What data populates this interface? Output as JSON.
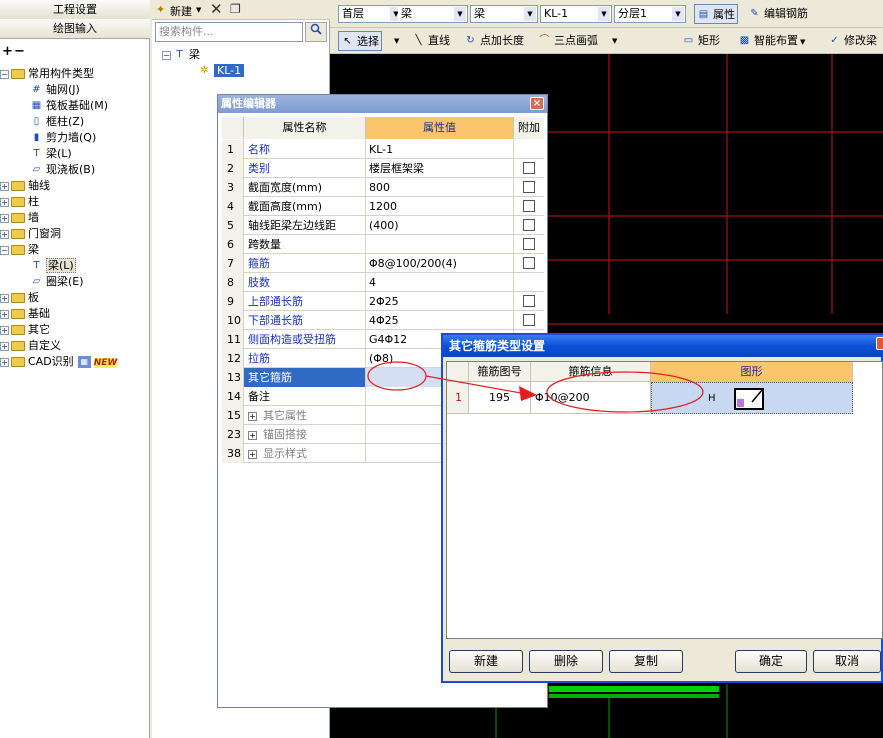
{
  "left_pane": {
    "buttons": [
      "工程设置",
      "绘图输入"
    ],
    "root_label": "常用构件类型",
    "common_items": [
      "轴网(J)",
      "筏板基础(M)",
      "框柱(Z)",
      "剪力墙(Q)",
      "梁(L)",
      "现浇板(B)"
    ],
    "folders_a": [
      "轴线",
      "柱",
      "墙",
      "门窗洞"
    ],
    "beam_folder": "梁",
    "beam_items": [
      "梁(L)",
      "圈梁(E)"
    ],
    "folders_b": [
      "板",
      "基础",
      "其它",
      "自定义"
    ],
    "cad_label": "CAD识别",
    "new_badge": "NEW"
  },
  "mid_pane": {
    "new_label": "新建",
    "search_placeholder": "搜索构件...",
    "tree_root": "梁",
    "tree_child": "KL-1"
  },
  "toolbar1": {
    "floor": "首层",
    "cat1": "梁",
    "cat2": "梁",
    "member": "KL-1",
    "sublayer": "分层1",
    "property": "属性",
    "edit_rebar": "编辑钢筋"
  },
  "toolbar2": {
    "select": "选择",
    "line": "直线",
    "point_length": "点加长度",
    "arc": "三点画弧",
    "rect": "矩形",
    "smart": "智能布置",
    "modify": "修改梁"
  },
  "prop_editor": {
    "title": "属性编辑器",
    "headers": {
      "name": "属性名称",
      "value": "属性值",
      "extra": "附加"
    },
    "rows": [
      {
        "num": "1",
        "name": "名称",
        "value": "KL-1",
        "blue": true,
        "check": false
      },
      {
        "num": "2",
        "name": "类别",
        "value": "楼层框架梁",
        "blue": true,
        "check": true
      },
      {
        "num": "3",
        "name": "截面宽度(mm)",
        "value": "800",
        "blue": false,
        "check": true
      },
      {
        "num": "4",
        "name": "截面高度(mm)",
        "value": "1200",
        "blue": false,
        "check": true
      },
      {
        "num": "5",
        "name": "轴线距梁左边线距",
        "value": "(400)",
        "blue": false,
        "check": true
      },
      {
        "num": "6",
        "name": "跨数量",
        "value": "",
        "blue": false,
        "check": true
      },
      {
        "num": "7",
        "name": "箍筋",
        "value": "Φ8@100/200(4)",
        "blue": true,
        "check": true
      },
      {
        "num": "8",
        "name": "肢数",
        "value": "4",
        "blue": true,
        "check": false
      },
      {
        "num": "9",
        "name": "上部通长筋",
        "value": "2Φ25",
        "blue": true,
        "check": true
      },
      {
        "num": "10",
        "name": "下部通长筋",
        "value": "4Φ25",
        "blue": true,
        "check": true
      },
      {
        "num": "11",
        "name": "侧面构造或受扭筋",
        "value": "G4Φ12",
        "blue": true,
        "check": false
      },
      {
        "num": "12",
        "name": "拉筋",
        "value": "(Φ8)",
        "blue": true,
        "check": false
      },
      {
        "num": "13",
        "name": "其它箍筋",
        "value": "",
        "blue": false,
        "check": false
      },
      {
        "num": "14",
        "name": "备注",
        "value": "",
        "blue": false,
        "check": false
      },
      {
        "num": "15",
        "name": "其它属性",
        "value": "",
        "blue": false,
        "check": false
      },
      {
        "num": "23",
        "name": "锚固搭接",
        "value": "",
        "blue": false,
        "check": false
      },
      {
        "num": "38",
        "name": "显示样式",
        "value": "",
        "blue": false,
        "check": false
      }
    ]
  },
  "stirrup_dialog": {
    "title": "其它箍筋类型设置",
    "headers": [
      "箍筋图号",
      "箍筋信息",
      "图形"
    ],
    "row": {
      "index": "1",
      "code": "195",
      "info": "Φ10@200",
      "shape_label": "H"
    },
    "buttons": {
      "new": "新建",
      "delete": "删除",
      "copy": "复制",
      "ok": "确定",
      "cancel": "取消"
    }
  },
  "colors": {
    "red_grid": "#cc1111",
    "green": "#00b000",
    "selection": "#316ac5",
    "title_blue": "#0a51d8"
  }
}
